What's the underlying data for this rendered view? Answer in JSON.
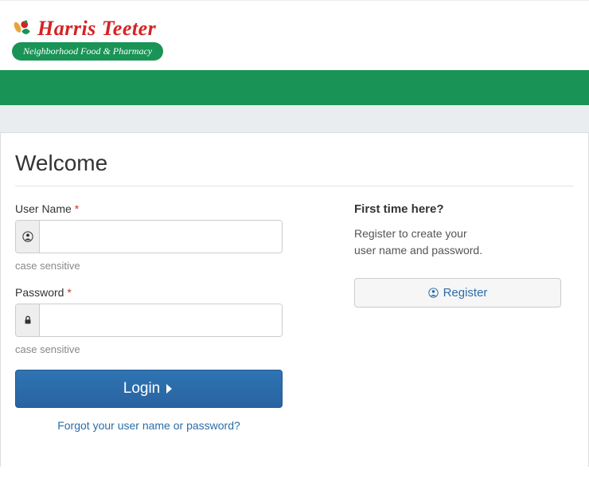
{
  "brand": {
    "name": "Harris Teeter",
    "tagline": "Neighborhood Food & Pharmacy"
  },
  "page": {
    "title": "Welcome"
  },
  "form": {
    "username": {
      "label": "User Name",
      "required": "*",
      "value": "",
      "helper": "case sensitive"
    },
    "password": {
      "label": "Password",
      "required": "*",
      "value": "",
      "helper": "case sensitive"
    },
    "login_label": "Login",
    "forgot_label": "Forgot your user name or password?"
  },
  "sidebar": {
    "heading": "First time here?",
    "line1": "Register to create your",
    "line2": "user name and password.",
    "register_label": "Register"
  }
}
